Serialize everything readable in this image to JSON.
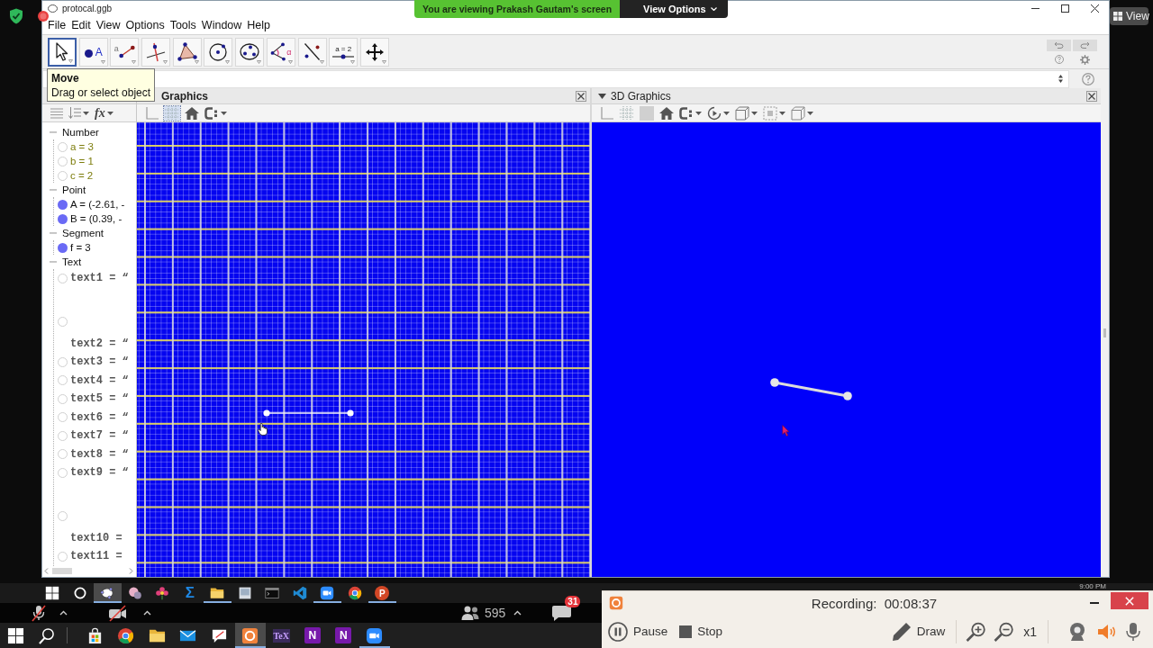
{
  "screen_share": {
    "banner": "You are viewing Prakash Gautam's screen",
    "options_button": "View Options",
    "view_button": "View"
  },
  "window": {
    "title": "protocal.ggb"
  },
  "menu": [
    "File",
    "Edit",
    "View",
    "Options",
    "Tools",
    "Window",
    "Help"
  ],
  "toolbar": {
    "tools": [
      {
        "kind": "move",
        "selected": true
      },
      {
        "kind": "point",
        "glyph": "A",
        "selected": false
      },
      {
        "kind": "segment",
        "glyph": "a",
        "selected": false
      },
      {
        "kind": "perpendicular",
        "selected": false
      },
      {
        "kind": "polygon",
        "selected": false
      },
      {
        "kind": "circle-center",
        "selected": false
      },
      {
        "kind": "circle-three",
        "selected": false
      },
      {
        "kind": "angle",
        "glyph": "α",
        "selected": false
      },
      {
        "kind": "reflect",
        "selected": false
      },
      {
        "kind": "slider",
        "glyph": "a = 2",
        "selected": false
      },
      {
        "kind": "pan",
        "selected": false
      }
    ]
  },
  "tooltip": {
    "title": "Move",
    "description": "Drag or select object"
  },
  "algebra": {
    "input_button": "fx",
    "categories": [
      {
        "name": "Number",
        "kind": "number",
        "expanded": true,
        "items": [
          {
            "kind": "row",
            "label": "a = 3",
            "visible": false
          },
          {
            "kind": "row",
            "label": "b = 1",
            "visible": false
          },
          {
            "kind": "row",
            "label": "c = 2",
            "visible": false
          }
        ]
      },
      {
        "name": "Point",
        "kind": "point",
        "expanded": true,
        "items": [
          {
            "kind": "row",
            "label": "A = (-2.61, -",
            "visible": true
          },
          {
            "kind": "row",
            "label": "B = (0.39, -",
            "visible": true
          }
        ]
      },
      {
        "name": "Segment",
        "kind": "segment",
        "expanded": true,
        "items": [
          {
            "kind": "row",
            "label": "f = 3",
            "visible": true
          }
        ]
      },
      {
        "name": "Text",
        "kind": "text",
        "expanded": true,
        "items": [
          {
            "kind": "row",
            "label": "text1 = “",
            "visible": false
          },
          {
            "kind": "blank",
            "visible": false
          },
          {
            "kind": "label",
            "label": "text2 = “"
          },
          {
            "kind": "row",
            "label": "text3 = “",
            "visible": false
          },
          {
            "kind": "row",
            "label": "text4 = “",
            "visible": false
          },
          {
            "kind": "row",
            "label": "text5 = “",
            "visible": false
          },
          {
            "kind": "row",
            "label": "text6 = “",
            "visible": false
          },
          {
            "kind": "row",
            "label": "text7 = “",
            "visible": false
          },
          {
            "kind": "row",
            "label": "text8 = “",
            "visible": false
          },
          {
            "kind": "row",
            "label": "text9 = “",
            "visible": false
          },
          {
            "kind": "blank",
            "visible": false
          },
          {
            "kind": "label",
            "label": "text10 ="
          },
          {
            "kind": "row",
            "label": "text11 =",
            "visible": false
          }
        ]
      }
    ]
  },
  "graphics": {
    "title": "Graphics",
    "focused": true,
    "toolbar": [
      {
        "kind": "axes",
        "on": false
      },
      {
        "kind": "grid",
        "on": true
      },
      {
        "kind": "home",
        "on": false
      },
      {
        "kind": "capture",
        "on": false
      }
    ]
  },
  "graphics_3d": {
    "title": "3D Graphics",
    "focused": false,
    "toolbar": [
      {
        "kind": "axes",
        "on": false
      },
      {
        "kind": "grid",
        "on": false
      },
      {
        "kind": "plane",
        "on": false
      },
      {
        "kind": "home",
        "on": false
      },
      {
        "kind": "capture",
        "on": false
      },
      {
        "kind": "rotate",
        "on": false
      },
      {
        "kind": "view",
        "on": false
      },
      {
        "kind": "clip",
        "on": false
      },
      {
        "kind": "projection",
        "on": false
      }
    ]
  },
  "shared_taskbar": {
    "apps": [
      {
        "kind": "start",
        "running": false,
        "selected": false
      },
      {
        "kind": "circle",
        "running": false,
        "selected": false
      },
      {
        "kind": "geogebra",
        "running": true,
        "selected": true
      },
      {
        "kind": "paint",
        "running": false,
        "selected": false
      },
      {
        "kind": "flower",
        "running": false,
        "selected": false
      },
      {
        "kind": "sigma",
        "glyph": "Σ",
        "running": false,
        "selected": false
      },
      {
        "kind": "folder",
        "running": true,
        "selected": false
      },
      {
        "kind": "window",
        "running": false,
        "selected": false
      },
      {
        "kind": "terminal",
        "running": false,
        "selected": false
      },
      {
        "kind": "code",
        "running": false,
        "selected": false
      },
      {
        "kind": "zoom",
        "running": true,
        "selected": false
      },
      {
        "kind": "chrome",
        "running": false,
        "selected": false
      },
      {
        "kind": "powerpoint",
        "glyph": "P",
        "running": true,
        "selected": false
      }
    ],
    "clock": "9:00 PM"
  },
  "meeting_bar": {
    "participants": "595",
    "chat_badge": "31"
  },
  "taskbar": {
    "apps": [
      {
        "kind": "start",
        "running": false,
        "selected": false
      },
      {
        "kind": "search",
        "running": false,
        "selected": false
      },
      {
        "kind": "store",
        "running": false,
        "selected": false
      },
      {
        "kind": "chrome",
        "running": false,
        "selected": false
      },
      {
        "kind": "folder",
        "running": false,
        "selected": false
      },
      {
        "kind": "mail",
        "running": false,
        "selected": false
      },
      {
        "kind": "snip",
        "running": false,
        "selected": false
      },
      {
        "kind": "recorder",
        "running": true,
        "selected": true
      },
      {
        "kind": "tex",
        "glyph": "TeX",
        "running": false,
        "selected": false
      },
      {
        "kind": "onenote",
        "glyph": "N",
        "running": false,
        "selected": false
      },
      {
        "kind": "onenote",
        "glyph": "N",
        "running": false,
        "selected": false
      },
      {
        "kind": "zoom",
        "running": true,
        "selected": false
      }
    ]
  },
  "recorder": {
    "status": "Recording:  00:08:37",
    "buttons": [
      {
        "kind": "pause",
        "label": "Pause"
      },
      {
        "kind": "stop",
        "label": "Stop"
      },
      {
        "kind": "draw",
        "label": "Draw"
      }
    ],
    "zoom_level": "x1",
    "devices": [
      {
        "kind": "webcam",
        "on": false
      },
      {
        "kind": "speaker",
        "on": true
      },
      {
        "kind": "mic",
        "on": false
      }
    ]
  }
}
